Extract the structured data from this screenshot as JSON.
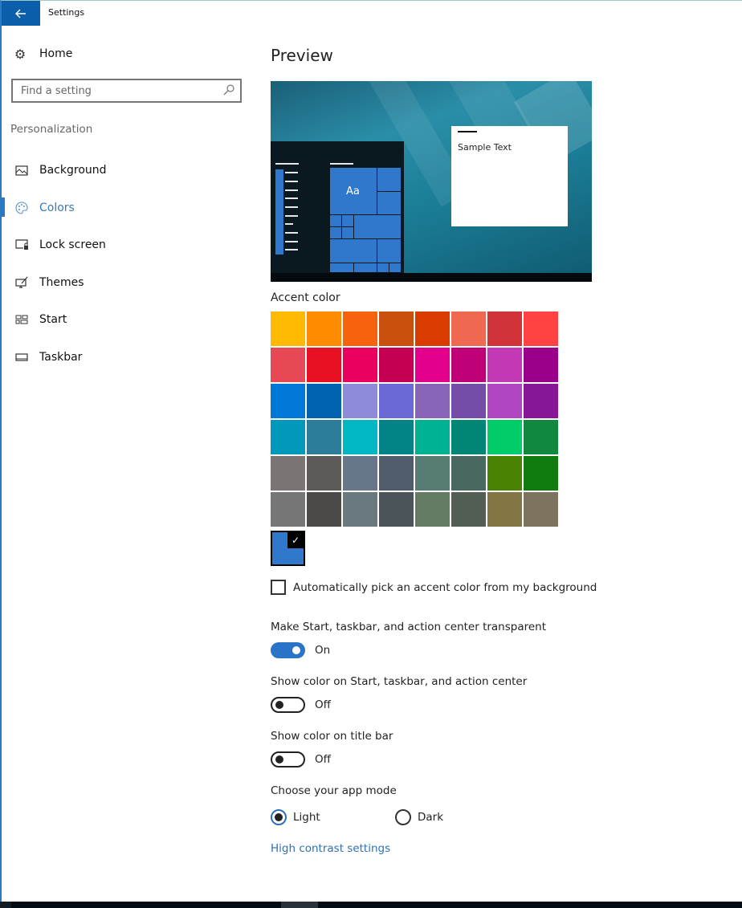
{
  "window": {
    "title": "Settings",
    "back_icon": "arrow-left-icon"
  },
  "sidebar": {
    "home_label": "Home",
    "home_icon": "gear-icon",
    "search_placeholder": "Find a setting",
    "search_icon": "search-icon",
    "group_label": "Personalization",
    "items": [
      {
        "label": "Background",
        "icon": "picture-icon",
        "active": false
      },
      {
        "label": "Colors",
        "icon": "palette-icon",
        "active": true
      },
      {
        "label": "Lock screen",
        "icon": "lock-screen-icon",
        "active": false
      },
      {
        "label": "Themes",
        "icon": "themes-icon",
        "active": false
      },
      {
        "label": "Start",
        "icon": "start-icon",
        "active": false
      },
      {
        "label": "Taskbar",
        "icon": "taskbar-icon",
        "active": false
      }
    ]
  },
  "main": {
    "preview_heading": "Preview",
    "preview": {
      "sample_text": "Sample Text",
      "tile_text": "Aa"
    },
    "accent_heading": "Accent color",
    "accent_colors": [
      "#FFB900",
      "#FF8C00",
      "#F7630C",
      "#CA5010",
      "#DA3B01",
      "#EF6950",
      "#D13438",
      "#FF4343",
      "#E74856",
      "#E81123",
      "#EA005E",
      "#C30052",
      "#E3008C",
      "#BF0077",
      "#C239B3",
      "#9A0089",
      "#0078D7",
      "#0063B1",
      "#8E8CD8",
      "#6B69D6",
      "#8764B8",
      "#744DA9",
      "#B146C2",
      "#881798",
      "#0099BC",
      "#2D7D9A",
      "#00B7C3",
      "#038387",
      "#00B294",
      "#018574",
      "#00CC6A",
      "#10893E",
      "#7A7574",
      "#5D5A58",
      "#68768A",
      "#515C6B",
      "#567C73",
      "#486860",
      "#498205",
      "#107C10",
      "#767676",
      "#4C4A48",
      "#69797E",
      "#4A5459",
      "#647C64",
      "#525E54",
      "#847545",
      "#7E735F"
    ],
    "selected_color": "#2F78CC",
    "selected_check_icon": "checkmark-icon",
    "auto_pick": {
      "label": "Automatically pick an accent color from my background",
      "checked": false
    },
    "transparency": {
      "label": "Make Start, taskbar, and action center transparent",
      "state": "On",
      "on": true
    },
    "show_color_start": {
      "label": "Show color on Start, taskbar, and action center",
      "state": "Off",
      "on": false
    },
    "show_color_title": {
      "label": "Show color on title bar",
      "state": "Off",
      "on": false
    },
    "app_mode": {
      "label": "Choose your app mode",
      "options": [
        {
          "label": "Light",
          "selected": true
        },
        {
          "label": "Dark",
          "selected": false
        }
      ]
    },
    "high_contrast_link": "High contrast settings"
  }
}
